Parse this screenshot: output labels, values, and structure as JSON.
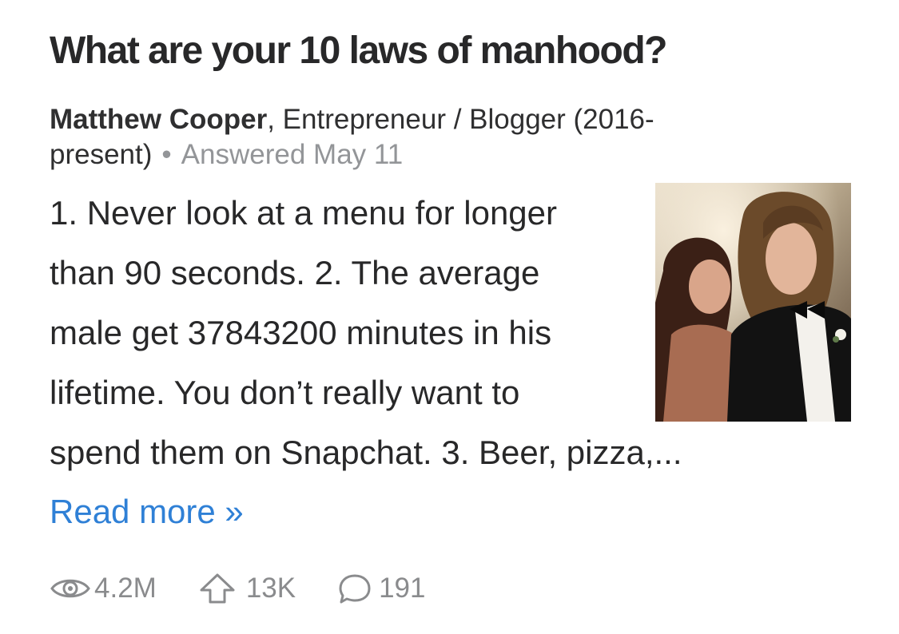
{
  "question": {
    "title": "What are your 10 laws of manhood?"
  },
  "answer": {
    "author": "Matthew Cooper",
    "credential_line1": ", Entrepreneur / Blogger (2016-",
    "credential_line2": "present)",
    "separator": "•",
    "answered": "Answered May 11",
    "excerpt_lines": [
      "1. Never look at a menu for longer",
      "than 90 seconds. 2. The average",
      "male get 37843200 minutes in his",
      "lifetime. You don’t really want to",
      "spend them on Snapchat. 3. Beer, pizza,..."
    ],
    "read_more": "Read more »"
  },
  "stats": {
    "views": "4.2M",
    "upvotes": "13K",
    "comments": "191"
  },
  "icons": {
    "views": "eye-icon",
    "upvotes": "upvote-arrow-icon",
    "comments": "comment-bubble-icon"
  },
  "colors": {
    "title": "#282829",
    "muted": "#939598",
    "link": "#2f80d6",
    "stat": "#8a8b8d"
  }
}
